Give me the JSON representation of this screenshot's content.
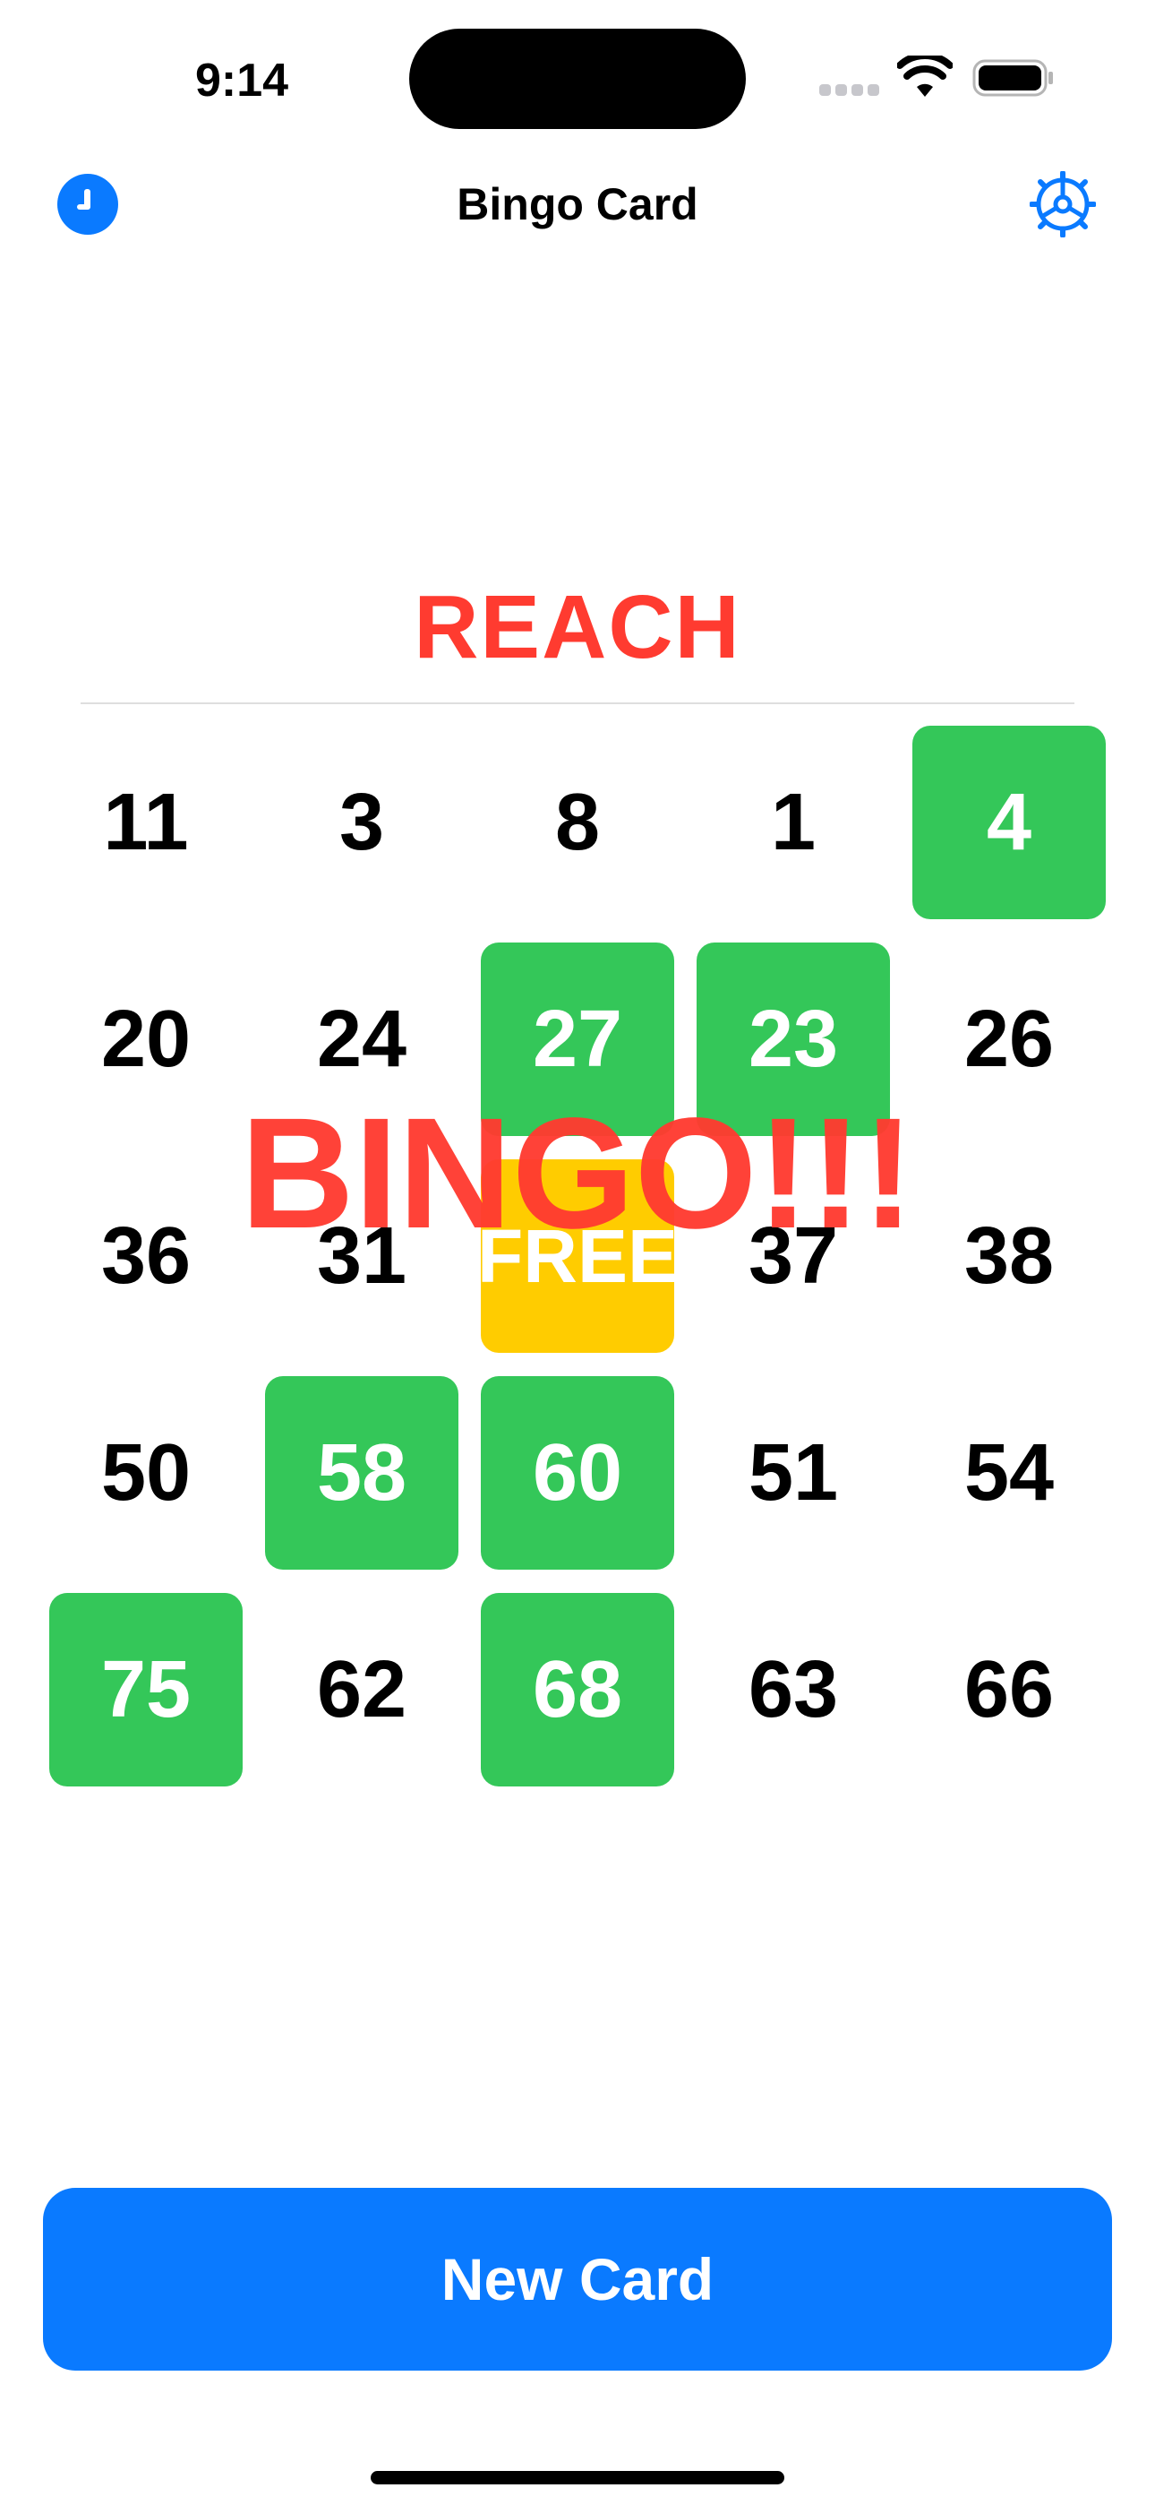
{
  "status_bar": {
    "time": "9:14"
  },
  "nav": {
    "title": "Bingo Card",
    "left_icon": "clock-icon",
    "right_icon": "gear-icon"
  },
  "game": {
    "status_label": "REACH",
    "result_label": "BINGO!!!",
    "cells": [
      {
        "label": "11",
        "state": "unmarked"
      },
      {
        "label": "3",
        "state": "unmarked"
      },
      {
        "label": "8",
        "state": "unmarked"
      },
      {
        "label": "1",
        "state": "unmarked"
      },
      {
        "label": "4",
        "state": "marked"
      },
      {
        "label": "20",
        "state": "unmarked"
      },
      {
        "label": "24",
        "state": "unmarked"
      },
      {
        "label": "27",
        "state": "marked"
      },
      {
        "label": "23",
        "state": "marked"
      },
      {
        "label": "26",
        "state": "unmarked"
      },
      {
        "label": "36",
        "state": "unmarked"
      },
      {
        "label": "31",
        "state": "unmarked"
      },
      {
        "label": "FREE",
        "state": "free"
      },
      {
        "label": "37",
        "state": "unmarked"
      },
      {
        "label": "38",
        "state": "unmarked"
      },
      {
        "label": "50",
        "state": "unmarked"
      },
      {
        "label": "58",
        "state": "marked"
      },
      {
        "label": "60",
        "state": "marked"
      },
      {
        "label": "51",
        "state": "unmarked"
      },
      {
        "label": "54",
        "state": "unmarked"
      },
      {
        "label": "75",
        "state": "marked"
      },
      {
        "label": "62",
        "state": "unmarked"
      },
      {
        "label": "68",
        "state": "marked"
      },
      {
        "label": "63",
        "state": "unmarked"
      },
      {
        "label": "66",
        "state": "unmarked"
      }
    ]
  },
  "actions": {
    "new_card_label": "New Card"
  },
  "colors": {
    "accent": "#0A7AFF",
    "marked": "#34C759",
    "free": "#FFCC00",
    "alert": "#FF3B30"
  }
}
